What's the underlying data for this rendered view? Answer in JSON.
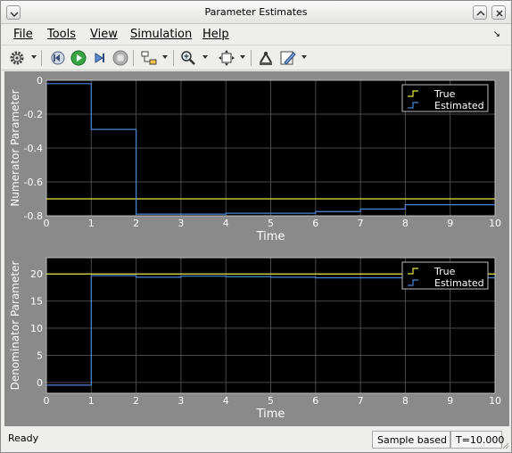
{
  "window": {
    "title": "Parameter Estimates"
  },
  "menu": {
    "items": [
      {
        "label": "File"
      },
      {
        "label": "Tools"
      },
      {
        "label": "View"
      },
      {
        "label": "Simulation"
      },
      {
        "label": "Help"
      }
    ]
  },
  "toolbar": {
    "icons": [
      "gear-icon",
      "step-back-icon",
      "run-icon",
      "step-forward-icon",
      "stop-icon",
      "highlight-block-icon",
      "zoom-icon",
      "autoscale-icon",
      "scope-properties-icon",
      "style-icon"
    ]
  },
  "status": {
    "text": "Ready",
    "mode": "Sample based",
    "time": "T=10.000"
  },
  "colors": {
    "plot_background": "#000000",
    "true_series": "#e6e640",
    "estimated_series": "#4a86d8",
    "figure_background": "#8a8a8a"
  },
  "chart_data": [
    {
      "type": "line",
      "step": true,
      "xlabel": "Time",
      "ylabel": "Numerator Parameter",
      "xlim": [
        0,
        10
      ],
      "ylim": [
        -0.8,
        0
      ],
      "xticks": [
        "0",
        "1",
        "2",
        "3",
        "4",
        "5",
        "6",
        "7",
        "8",
        "9",
        "10"
      ],
      "yticks": [
        "0",
        "-0.2",
        "-0.4",
        "-0.6",
        "-0.8"
      ],
      "grid": true,
      "legend_position": "top-right",
      "series": [
        {
          "name": "True",
          "color": "#e6e640",
          "x": [
            0,
            10
          ],
          "y": [
            -0.7,
            -0.7
          ]
        },
        {
          "name": "Estimated",
          "color": "#4a86d8",
          "x": [
            0,
            1,
            2,
            3,
            4,
            5,
            6,
            7,
            8,
            9,
            10
          ],
          "y": [
            -0.02,
            -0.29,
            -0.79,
            -0.79,
            -0.785,
            -0.785,
            -0.775,
            -0.76,
            -0.735,
            -0.735,
            -0.735
          ]
        }
      ]
    },
    {
      "type": "line",
      "step": true,
      "xlabel": "Time",
      "ylabel": "Denominator Parameter",
      "xlim": [
        0,
        10
      ],
      "ylim": [
        -2,
        23
      ],
      "xticks": [
        "0",
        "1",
        "2",
        "3",
        "4",
        "5",
        "6",
        "7",
        "8",
        "9",
        "10"
      ],
      "yticks": [
        "20",
        "15",
        "10",
        "5",
        "0"
      ],
      "ytick_values": [
        20,
        15,
        10,
        5,
        0
      ],
      "grid": true,
      "legend_position": "top-right",
      "series": [
        {
          "name": "True",
          "color": "#e6e640",
          "x": [
            0,
            10
          ],
          "y": [
            20,
            20
          ]
        },
        {
          "name": "Estimated",
          "color": "#4a86d8",
          "x": [
            0,
            1,
            2,
            3,
            4,
            5,
            6,
            7,
            8,
            9,
            10
          ],
          "y": [
            -0.5,
            19.7,
            19.4,
            19.6,
            19.5,
            19.4,
            19.3,
            19.3,
            19.3,
            19.3,
            19.3
          ]
        }
      ]
    }
  ]
}
